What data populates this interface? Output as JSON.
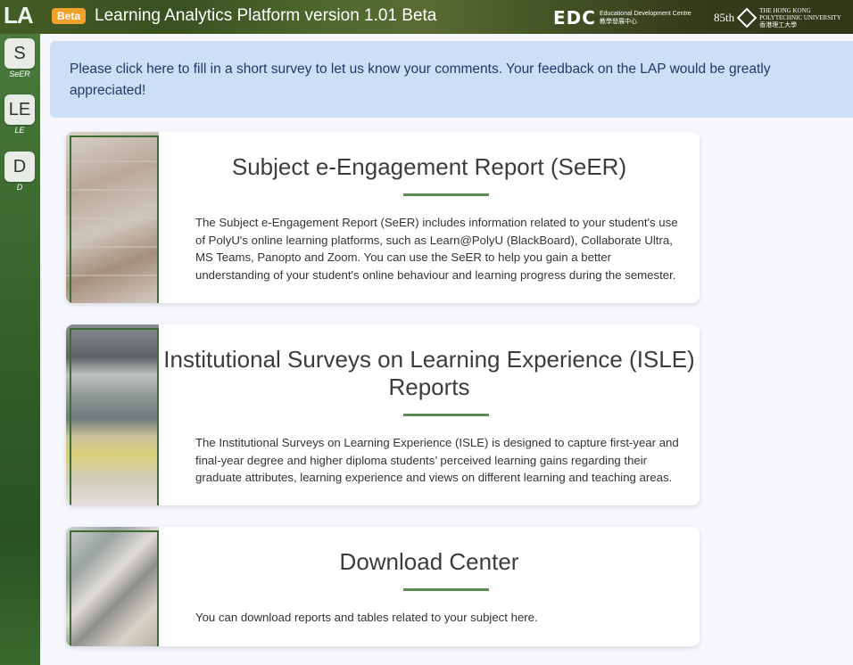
{
  "header": {
    "logo": "LA",
    "beta_badge": "Beta",
    "title": "Learning Analytics Platform version 1.01 Beta",
    "edc_mark": "EDC",
    "edc_name_en": "Educational Development Centre",
    "edc_name_zh": "教學發展中心",
    "polyu_anniversary": "85th",
    "polyu_name_en_1": "THE HONG KONG",
    "polyu_name_en_2": "POLYTECHNIC UNIVERSITY",
    "polyu_name_zh": "香港理工大學"
  },
  "sidebar": {
    "items": [
      {
        "letter": "S",
        "label": "SeER"
      },
      {
        "letter": "LE",
        "label": "LE"
      },
      {
        "letter": "D",
        "label": "D"
      }
    ]
  },
  "banner": {
    "text": "Please click here to fill in a short survey to let us know your comments. Your feedback on the LAP would be greatly appreciated!"
  },
  "cards": [
    {
      "title": "Subject e-Engagement Report (SeER)",
      "description": "The Subject e-Engagement Report (SeER) includes information related to your student's use of PolyU's online learning platforms, such as Learn@PolyU (BlackBoard), Collaborate Ultra, MS Teams, Panopto and Zoom. You can use the SeER to help you gain a better understanding of your student's online behaviour and learning progress during the semester."
    },
    {
      "title": "Institutional Surveys on Learning Experience (ISLE) Reports",
      "description": "The Institutional Surveys on Learning Experience (ISLE) is designed to capture first-year and final-year degree and higher diploma students’ perceived learning gains regarding their graduate attributes, learning experience and views on different learning and teaching areas."
    },
    {
      "title": "Download Center",
      "description": "You can download reports and tables related to your subject here."
    }
  ],
  "colors": {
    "accent_green": "#5d8a55",
    "banner_bg": "#cddff7",
    "beta_orange": "#f2a02a"
  }
}
